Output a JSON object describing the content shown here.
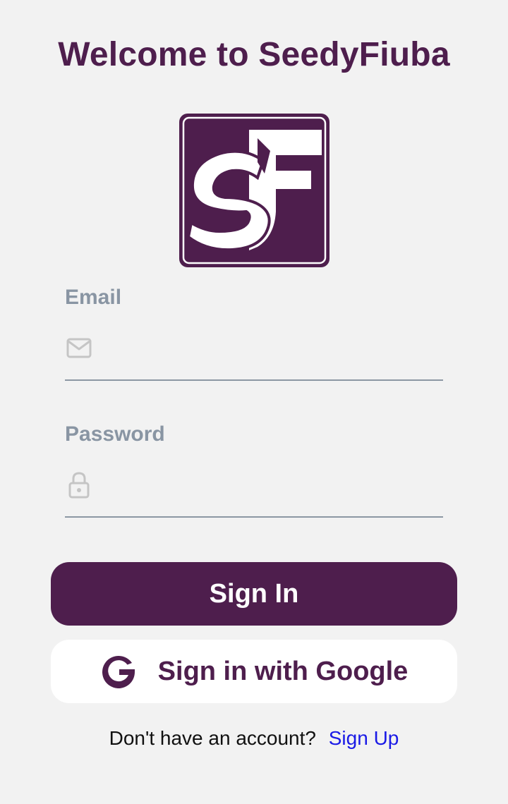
{
  "header": {
    "title": "Welcome to SeedyFiuba"
  },
  "logo": {
    "name": "seedyfiuba-logo",
    "letters": "SF"
  },
  "form": {
    "email": {
      "label": "Email",
      "value": "",
      "placeholder": "",
      "icon": "mail-icon"
    },
    "password": {
      "label": "Password",
      "value": "",
      "placeholder": "",
      "icon": "lock-icon"
    }
  },
  "actions": {
    "sign_in_label": "Sign In",
    "google_label": "Sign in with Google",
    "google_icon": "google-icon"
  },
  "footer": {
    "prompt": "Don't have an account?",
    "link_label": "Sign Up"
  },
  "colors": {
    "brand": "#4e1e4d",
    "background": "#f2f2f2",
    "label": "#8995a3",
    "link": "#1a1ae6"
  }
}
